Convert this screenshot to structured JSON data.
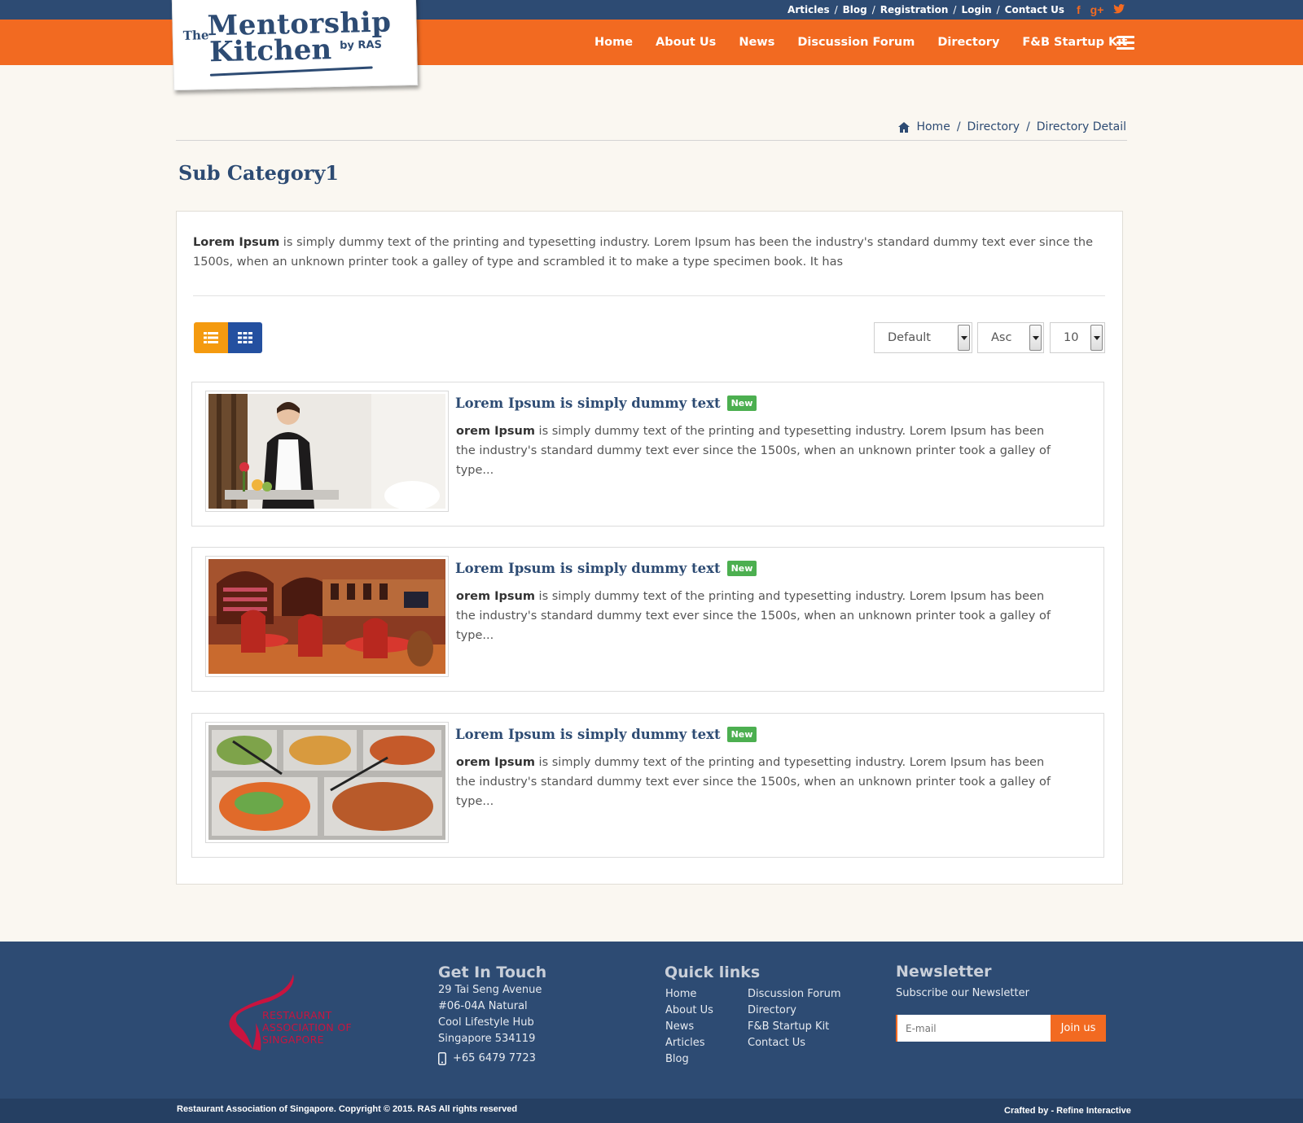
{
  "top_links": {
    "articles": "Articles",
    "blog": "Blog",
    "registration": "Registration",
    "login": "Login",
    "contact": "Contact Us",
    "separator": "/"
  },
  "social": {
    "facebook": "f",
    "google": "g+",
    "twitter": "t"
  },
  "logo": {
    "the": "The",
    "line1": "Mentorship",
    "line2": "Kitchen",
    "by": "by RAS"
  },
  "nav": [
    "Home",
    "About Us",
    "News",
    "Discussion Forum",
    "Directory",
    "F&B Startup Kit"
  ],
  "breadcrumb": {
    "home": "Home",
    "directory": "Directory",
    "detail": "Directory Detail",
    "separator": "/"
  },
  "page_title": "Sub Category1",
  "intro": {
    "bold": "Lorem Ipsum",
    "text": " is simply dummy text of the printing and typesetting industry. Lorem Ipsum has been the industry's standard dummy text ever since the 1500s, when an unknown printer took a galley of type and scrambled it to make a type specimen book. It has"
  },
  "controls": {
    "sort": "Default",
    "order": "Asc",
    "per_page": "10"
  },
  "listings": [
    {
      "title": "Lorem Ipsum is simply dummy text",
      "badge": "New",
      "bold": "orem Ipsum",
      "desc": " is simply dummy text of the printing and typesetting industry. Lorem Ipsum has been the industry's standard dummy text ever since the 1500s, when an unknown printer took a galley of type..."
    },
    {
      "title": "Lorem Ipsum is simply dummy text",
      "badge": "New",
      "bold": "orem Ipsum",
      "desc": " is simply dummy text of the printing and typesetting industry. Lorem Ipsum has been the industry's standard dummy text ever since the 1500s, when an unknown printer took a galley of type..."
    },
    {
      "title": "Lorem Ipsum is simply dummy text",
      "badge": "New",
      "bold": "orem Ipsum",
      "desc": " is simply dummy text of the printing and typesetting industry. Lorem Ipsum has been the industry's standard dummy text ever since the 1500s, when an unknown printer took a galley of type..."
    }
  ],
  "footer": {
    "ras_logo_lines": [
      "RESTAURANT",
      "ASSOCIATION OF",
      "SINGAPORE"
    ],
    "contact_heading": "Get In Touch",
    "address": [
      "29 Tai Seng Avenue",
      "#06-04A Natural",
      "Cool Lifestyle Hub",
      "Singapore 534119"
    ],
    "phone": "+65 6479 7723",
    "quick_heading": "Quick links",
    "quick_col1": [
      "Home",
      "About Us",
      "News",
      "Articles",
      "Blog"
    ],
    "quick_col2": [
      "Discussion Forum",
      "Directory",
      "F&B Startup Kit",
      "Contact Us"
    ],
    "newsletter_heading": "Newsletter",
    "newsletter_sub": "Subscribe our Newsletter",
    "email_placeholder": "E-mail",
    "join_label": "Join us",
    "copyright": "Restaurant Association of Singapore. Copyright © 2015. RAS All rights reserved",
    "crafted": "Crafted by - Refine Interactive"
  },
  "colors": {
    "navy": "#2d4b73",
    "orange": "#f26a21",
    "badge_green": "#4caf50",
    "list_button": "#f49a0f",
    "grid_button": "#2450a0",
    "ras_red": "#c8143f"
  }
}
